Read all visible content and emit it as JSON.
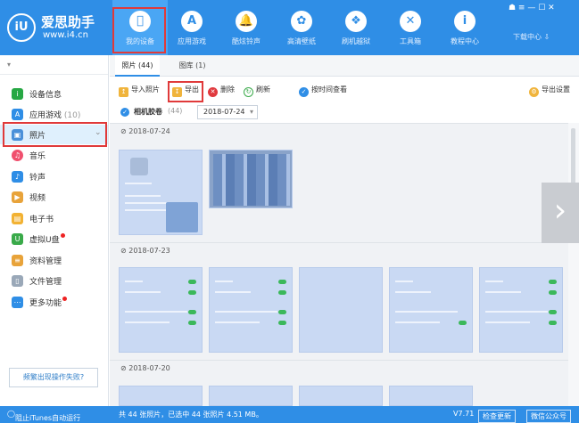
{
  "app": {
    "logo_mark": "iU",
    "name": "爱思助手",
    "url": "www.i4.cn"
  },
  "nav": [
    {
      "label": "我的设备",
      "icon": "apple-icon",
      "glyph": ""
    },
    {
      "label": "应用游戏",
      "icon": "app-store-icon",
      "glyph": "A"
    },
    {
      "label": "酷炫铃声",
      "icon": "bell-icon",
      "glyph": "🔔"
    },
    {
      "label": "高清壁纸",
      "icon": "flower-icon",
      "glyph": "✿"
    },
    {
      "label": "刷机越狱",
      "icon": "box-icon",
      "glyph": "❖"
    },
    {
      "label": "工具箱",
      "icon": "tools-icon",
      "glyph": "✕"
    },
    {
      "label": "教程中心",
      "icon": "info-icon",
      "glyph": "i"
    }
  ],
  "window": {
    "controls": "☗  ≡  —  ☐  ✕",
    "download": "下载中心 ⇩"
  },
  "sidebar": {
    "dropdown": "▾",
    "items": [
      {
        "label": "设备信息",
        "count": "",
        "color": "#27a844",
        "glyph": "i"
      },
      {
        "label": "应用游戏",
        "count": "(10)",
        "color": "#2f8ee6",
        "glyph": "A"
      },
      {
        "label": "照片",
        "count": "",
        "color": "#4a90d9",
        "glyph": "▣",
        "arrow": "⌄"
      },
      {
        "label": "音乐",
        "count": "",
        "color": "#f0506e",
        "glyph": "♫"
      },
      {
        "label": "铃声",
        "count": "",
        "color": "#2f8ee6",
        "glyph": "♪"
      },
      {
        "label": "视频",
        "count": "",
        "color": "#e8a33a",
        "glyph": "▶"
      },
      {
        "label": "电子书",
        "count": "",
        "color": "#f2b233",
        "glyph": "▤"
      },
      {
        "label": "虚拟U盘",
        "count": "",
        "color": "#3aaa4a",
        "glyph": "U"
      },
      {
        "label": "资料管理",
        "count": "",
        "color": "#e8a33a",
        "glyph": "≡"
      },
      {
        "label": "文件管理",
        "count": "",
        "color": "#9aa8b8",
        "glyph": "▯"
      },
      {
        "label": "更多功能",
        "count": "",
        "color": "#2f8ee6",
        "glyph": "⋯"
      }
    ],
    "fail_button": "频繁出现操作失败?"
  },
  "tabs": [
    {
      "label": "照片 (44)"
    },
    {
      "label": "图库 (1)"
    }
  ],
  "toolbar": {
    "import": "导入照片",
    "export": "导出",
    "delete": "删除",
    "refresh": "刷新",
    "by_time": "按时间查看",
    "export_settings": "导出设置"
  },
  "filter": {
    "album": "相机胶卷",
    "album_count": "(44)",
    "date": "2018-07-24",
    "caret": "▾"
  },
  "groups": [
    {
      "date": "2018-07-24"
    },
    {
      "date": "2018-07-23"
    },
    {
      "date": "2018-07-20"
    }
  ],
  "status": {
    "itunes": "阻止iTunes自动运行",
    "summary": "共 44 张照片，已选中 44 张照片 4.51 MB。",
    "version": "V7.71",
    "update": "检查更新",
    "wechat": "微信公众号"
  }
}
